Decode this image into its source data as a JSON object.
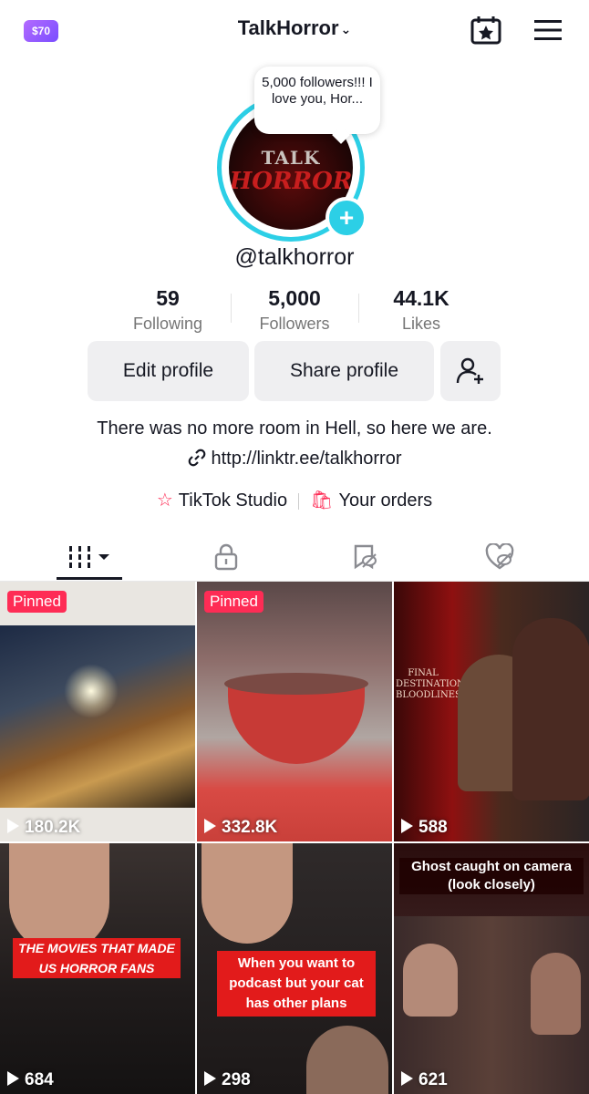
{
  "header": {
    "coin_label": "$70",
    "username": "TalkHorror",
    "menu_icon": "hamburger-icon",
    "calendar_icon": "calendar-star-icon"
  },
  "profile": {
    "note": "5,000 followers!!! I love you, Hor...",
    "avatar_text_top": "TALK",
    "avatar_text_bottom": "HORROR",
    "handle": "@talkhorror",
    "stats": [
      {
        "value": "59",
        "label": "Following"
      },
      {
        "value": "5,000",
        "label": "Followers"
      },
      {
        "value": "44.1K",
        "label": "Likes"
      }
    ],
    "buttons": {
      "edit": "Edit profile",
      "share": "Share profile"
    },
    "bio": "There was no more room in Hell, so here we are.",
    "link": "http://linktr.ee/talkhorror",
    "studio": "TikTok Studio",
    "orders": "Your orders"
  },
  "videos": [
    {
      "pinned": "Pinned",
      "views": "180.2K"
    },
    {
      "pinned": "Pinned",
      "views": "332.8K"
    },
    {
      "pinned": "",
      "views": "588",
      "poster_text": "FINAL DESTINATION BLOODLINES"
    },
    {
      "pinned": "",
      "views": "684",
      "caption": "THE MOVIES THAT MADE US HORROR FANS"
    },
    {
      "pinned": "",
      "views": "298",
      "caption": "When you want to podcast but your cat has other plans"
    },
    {
      "pinned": "",
      "views": "621",
      "caption": "Ghost caught on camera (look closely)"
    }
  ],
  "colors": {
    "accent": "#fe2c55",
    "ring": "#2ccfe6",
    "button_bg": "#efeff1"
  }
}
